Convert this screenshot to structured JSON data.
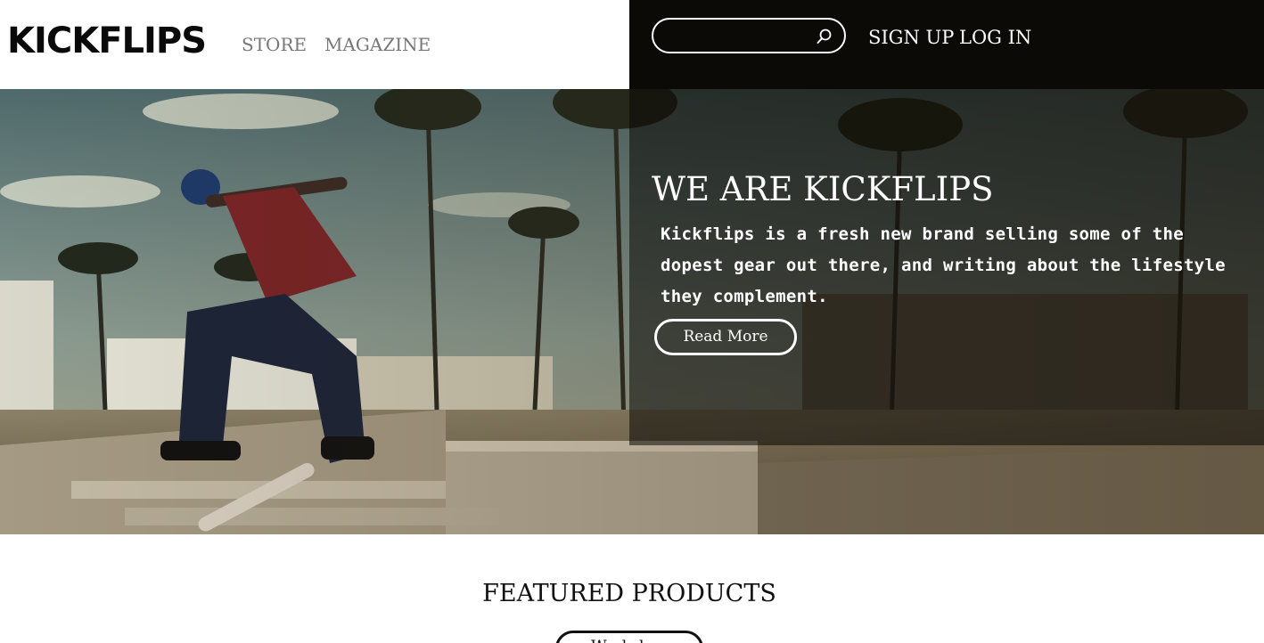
{
  "header": {
    "logo": "KICKFLIPS",
    "nav": {
      "store": "STORE",
      "magazine": "MAGAZINE"
    },
    "search": {
      "value": "",
      "placeholder": "",
      "icon": "search-icon"
    },
    "auth": {
      "signup": "SIGN UP",
      "login": "LOG IN"
    }
  },
  "hero": {
    "title": "WE ARE KICKFLIPS",
    "description": "Kickflips is a fresh new brand selling some of the dopest gear out there, and writing about the lifestyle they complement.",
    "button_label": "Read More",
    "image": "skateboarder-kickflip-photo"
  },
  "featured": {
    "title": "FEATURED PRODUCTS",
    "button_label": "Workshop"
  },
  "colors": {
    "header_dark": "#0b0a06",
    "text_light": "#ffffff",
    "nav_gray": "#777777",
    "text_dark": "#111111"
  }
}
